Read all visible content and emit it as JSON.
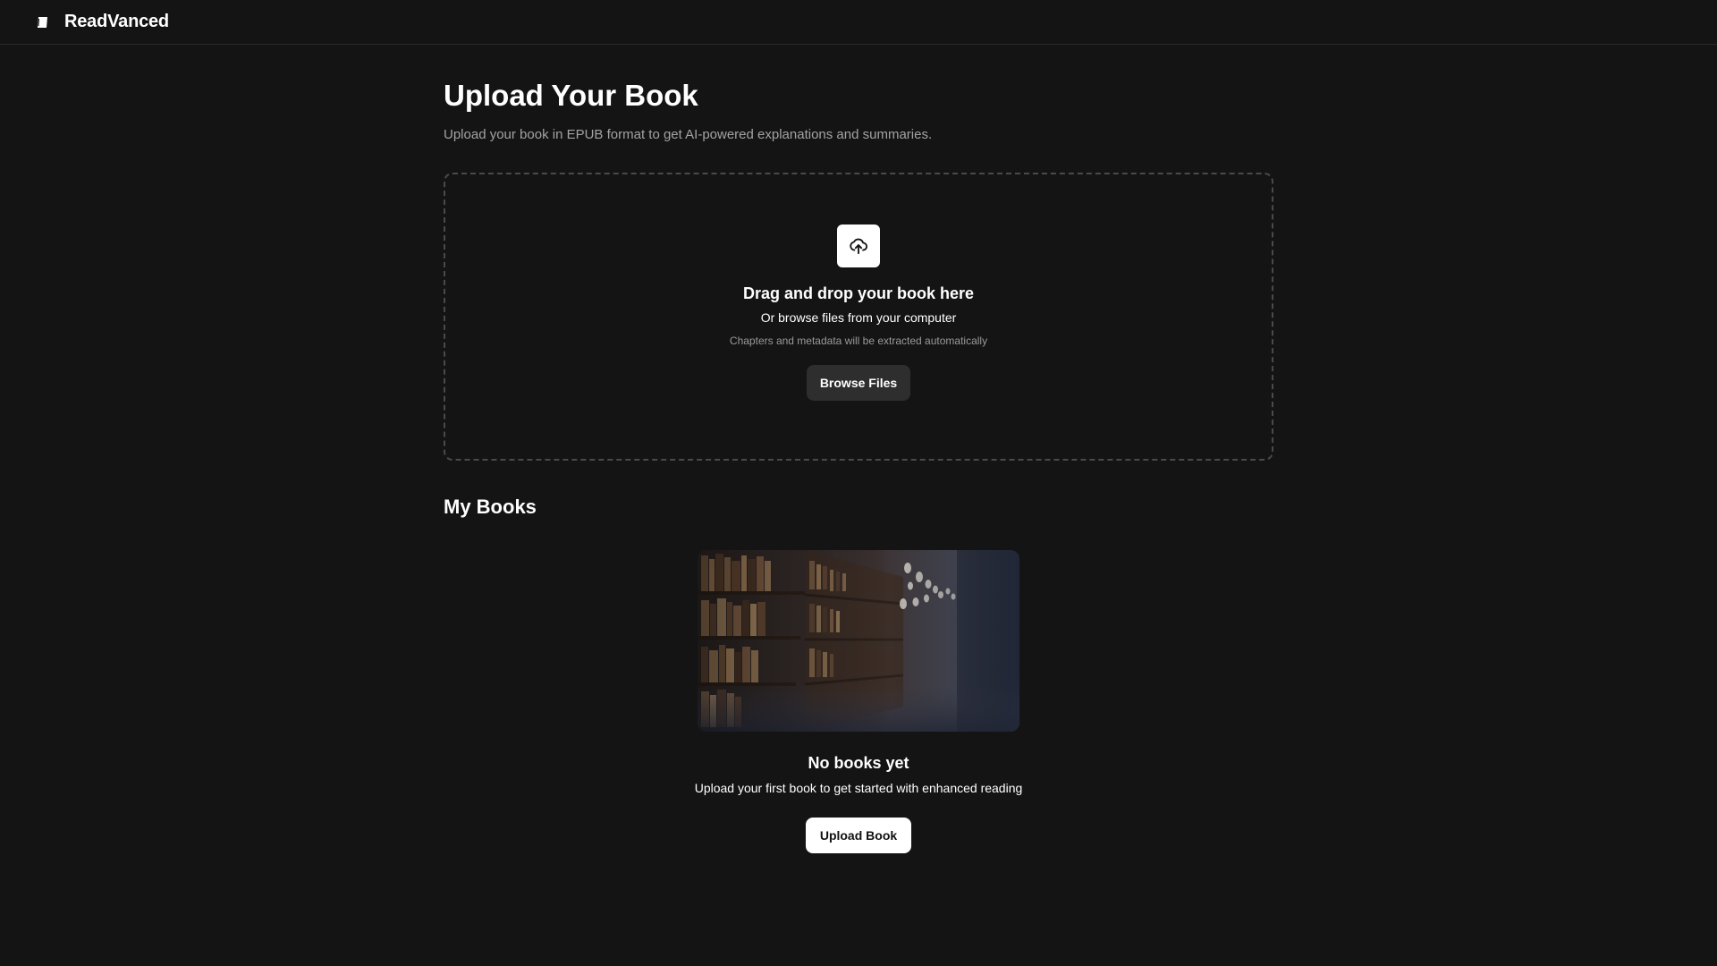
{
  "app": {
    "name": "ReadVanced",
    "logo_icon": "book-icon"
  },
  "upload_section": {
    "title": "Upload Your Book",
    "subtitle": "Upload your book in EPUB format to get AI-powered explanations and summaries.",
    "dropzone": {
      "icon": "cloud-upload-icon",
      "title": "Drag and drop your book here",
      "subtitle": "Or browse files from your computer",
      "hint": "Chapters and metadata will be extracted automatically",
      "browse_label": "Browse Files"
    }
  },
  "my_books": {
    "title": "My Books",
    "empty_state": {
      "image": "library-bookshelves-photo",
      "title": "No books yet",
      "subtitle": "Upload your first book to get started with enhanced reading",
      "button_label": "Upload Book"
    }
  },
  "colors": {
    "background": "#141414",
    "border": "#2a2a2a",
    "dashed_border": "#4a4a4a",
    "muted_text": "#a3a3a3",
    "secondary_button": "#2e2e2e",
    "primary_button": "#ffffff"
  }
}
